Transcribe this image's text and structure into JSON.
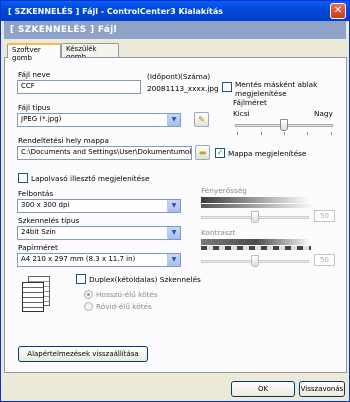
{
  "window": {
    "title": "[ SZKENNELÉS ]  Fájl - ControlCenter3 Kialakítás",
    "close_glyph": "✕",
    "banner": "[ SZKENNELÉS ]   Fájl"
  },
  "tabs": [
    {
      "label": "Szoftver gomb",
      "active": true
    },
    {
      "label": "Készülék gomb",
      "active": false
    }
  ],
  "file": {
    "name_label": "Fájl neve",
    "name_value": "CCF",
    "timestamp_label": "(Időpont)",
    "number_label": "(Száma)",
    "timestamp_value": "20081113_xxxx.jpg",
    "save_as_label": "Mentés másként ablak megjelenítése",
    "type_label": "Fájl típus",
    "type_value": "JPEG (*.jpg)",
    "size_label": "Fájlméret",
    "size_small": "Kicsi",
    "size_large": "Nagy",
    "size_level": 0.5,
    "dest_label": "Rendeltetési hely mappa",
    "dest_value": "C:\\Documents and Settings\\User\\Dokumentumok\\Ké",
    "show_folder_label": "Mappa megjelenítése"
  },
  "scan": {
    "prescan_label": "Lapolvasó illesztő megjelenítése",
    "resolution_label": "Felbontás",
    "resolution_value": "300 x 300 dpi",
    "scantype_label": "Szkennelés típus",
    "scantype_value": "24bit Szín",
    "paper_label": "Papírméret",
    "paper_value": "A4 210 x 297 mm (8.3 x 11.7 in)",
    "brightness_label": "Fényerősség",
    "brightness_value": "50",
    "contrast_label": "Kontraszt",
    "contrast_value": "50",
    "duplex_label": "Duplex(kétoldalas) Szkennelés",
    "long_edge_label": "Hosszú-élű kötés",
    "short_edge_label": "Rövid-élű kötés"
  },
  "buttons": {
    "reset": "Alapértelmezések visszaállítása",
    "ok": "OK",
    "cancel": "Visszavonás"
  },
  "colors": {
    "titlebar": "#0054e3",
    "banner": "#8fa2c8",
    "tab_highlight": "#f2ba4b",
    "check": "#21a121"
  }
}
